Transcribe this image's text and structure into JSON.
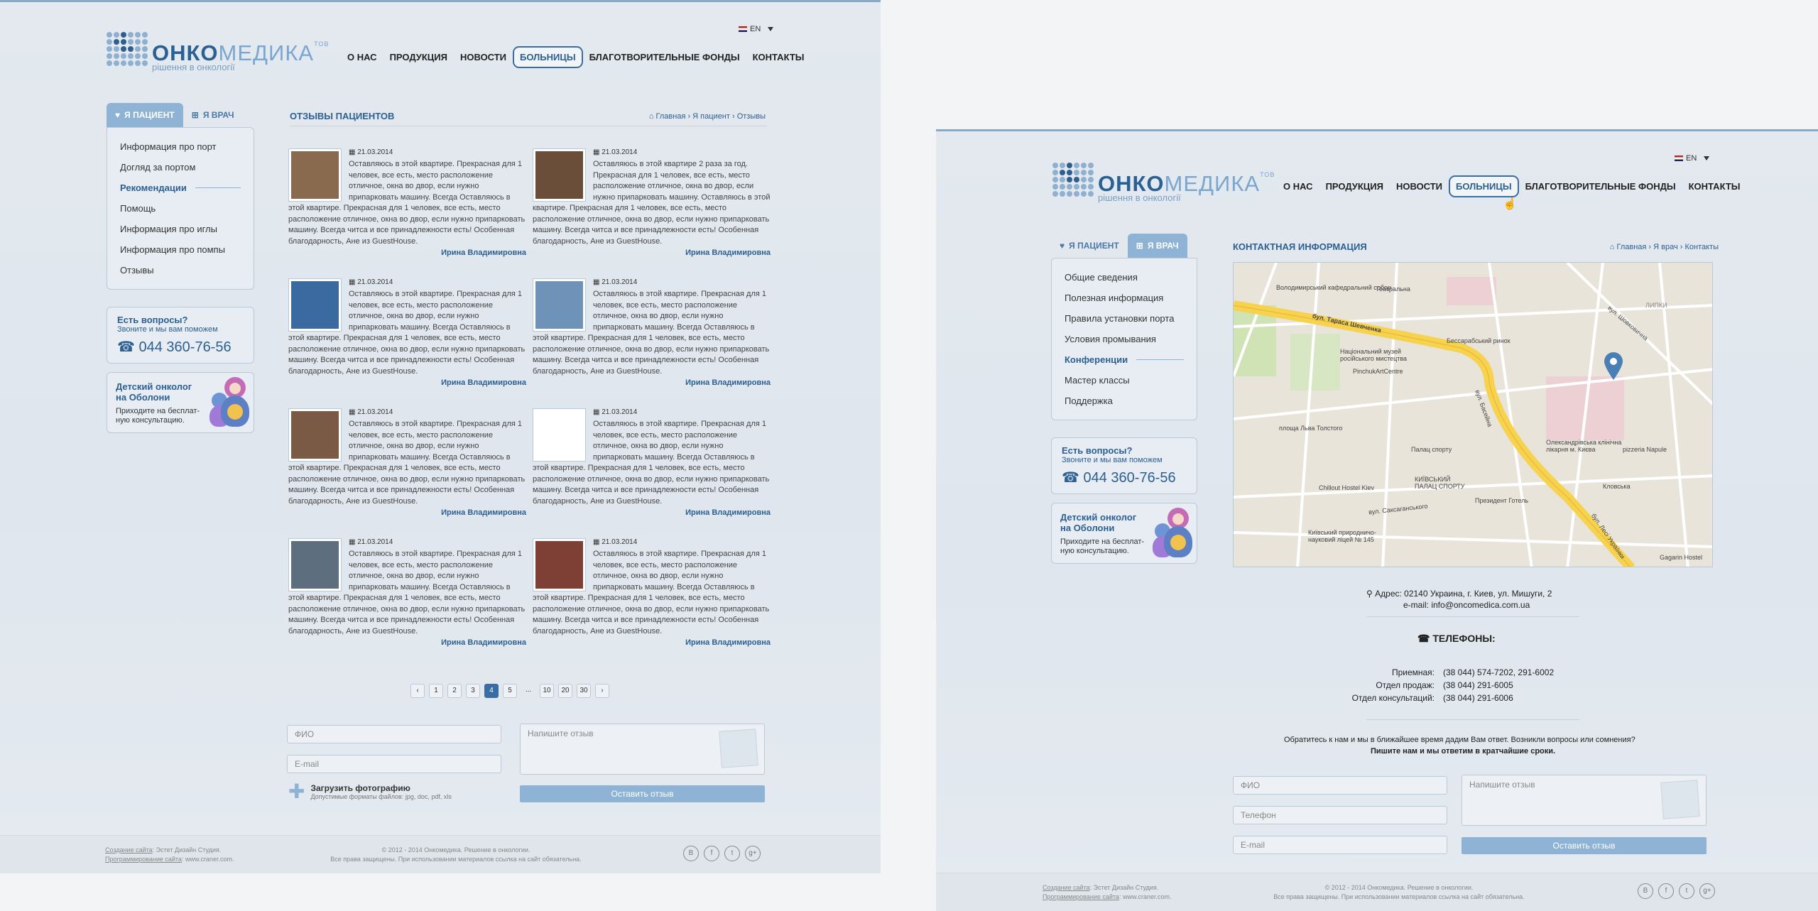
{
  "common": {
    "logo_main": "ОНКО",
    "logo_accent": "МЕДИКА",
    "logo_sup": "TOB",
    "logo_sub": "рішення в онкології",
    "lang": "EN",
    "nav": [
      "О НАС",
      "ПРОДУКЦИЯ",
      "НОВОСТИ",
      "БОЛЬНИЦЫ",
      "БЛАГОТВОРИТЕЛЬНЫЕ ФОНДЫ",
      "КОНТАКТЫ"
    ],
    "tab_patient": "Я ПАЦИЕНТ",
    "tab_doctor": "Я ВРАЧ",
    "question": {
      "title": "Есть вопросы?",
      "sub": "Звоните и мы вам поможем",
      "phone": "044 360-76-56"
    },
    "kids": {
      "title_1": "Детский онколог",
      "title_2": "на Оболони",
      "text_1": "Приходите на бесплат-",
      "text_2": "ную консультацию."
    },
    "footer": {
      "created_label": "Создание сайта",
      "created_by": ": Эстет Дизайн Студия.",
      "prog_label": "Программирование сайта",
      "prog_by": ": www.craner.com.",
      "copy_1": "© 2012 - 2014 Онкомедика. Решение в онкологии.",
      "copy_2": "Все права защищены. При использовании материалов ссылка на сайт обязательна."
    },
    "social": [
      "B",
      "f",
      "t",
      "g+"
    ],
    "form": {
      "name": "ФИО",
      "phone": "Телефон",
      "email": "E-mail",
      "message": "Напишите отзыв",
      "submit": "Оставить отзыв",
      "upload": "Загрузить фотографию",
      "upload_hint": "Допустимые форматы файлов: jpg, doc, pdf, xls"
    }
  },
  "page1": {
    "menu": [
      "Информация про порт",
      "Догляд за портом",
      "Рекомендации",
      "Помощь",
      "Информация про иглы",
      "Информация про помпы",
      "Отзывы"
    ],
    "section_title": "ОТЗЫВЫ ПАЦИЕНТОВ",
    "breadcrumb": "Главная › Я пациент › Отзывы",
    "reviews": [
      {
        "date": "21.03.2014",
        "text": "Оставляюсь в этой квартире. Прекрасная для 1 человек, все есть, место расположение отличное, окна во двор, если нужно припарковать машину. Всегда Оставляюсь в этой квартире. Прекрасная для 1 человек, все есть, место расположение отличное, окна во двор, если нужно припарковать машину. Всегда читса и все принадлежности есть! Особенная благодарность, Ане из GuestHouse.",
        "author": "Ирина Владимировна"
      },
      {
        "date": "21.03.2014",
        "text": "Оставляюсь в этой квартире 2 раза за год. Прекрасная для 1 человек, все есть, место расположение отличное, окна во двор, если нужно припарковать машину. Оставляюсь в этой квартире. Прекрасная для 1 человек, все есть, место расположение отличное, окна во двор, если нужно припарковать машину. Всегда читса и все принадлежности есть! Особенная благодарность, Ане из GuestHouse.",
        "author": "Ирина Владимировна"
      },
      {
        "date": "21.03.2014",
        "text": "Оставляюсь в этой квартире. Прекрасная для 1 человек, все есть, место расположение отличное, окна во двор, если нужно припарковать машину. Всегда Оставляюсь в этой квартире. Прекрасная для 1 человек, все есть, место расположение отличное, окна во двор, если нужно припарковать машину. Всегда читса и все принадлежности есть! Особенная благодарность, Ане из GuestHouse.",
        "author": "Ирина Владимировна"
      },
      {
        "date": "21.03.2014",
        "text": "Оставляюсь в этой квартире. Прекрасная для 1 человек, все есть, место расположение отличное, окна во двор, если нужно припарковать машину. Всегда Оставляюсь в этой квартире. Прекрасная для 1 человек, все есть, место расположение отличное, окна во двор, если нужно припарковать машину. Всегда читса и все принадлежности есть! Особенная благодарность, Ане из GuestHouse.",
        "author": "Ирина Владимировна"
      },
      {
        "date": "21.03.2014",
        "text": "Оставляюсь в этой квартире. Прекрасная для 1 человек, все есть, место расположение отличное, окна во двор, если нужно припарковать машину. Всегда Оставляюсь в этой квартире. Прекрасная для 1 человек, все есть, место расположение отличное, окна во двор, если нужно припарковать машину. Всегда читса и все принадлежности есть! Особенная благодарность, Ане из GuestHouse.",
        "author": "Ирина Владимировна"
      },
      {
        "date": "21.03.2014",
        "text": "Оставляюсь в этой квартире. Прекрасная для 1 человек, все есть, место расположение отличное, окна во двор, если нужно припарковать машину. Всегда Оставляюсь в этой квартире. Прекрасная для 1 человек, все есть, место расположение отличное, окна во двор, если нужно припарковать машину. Всегда читса и все принадлежности есть! Особенная благодарность, Ане из GuestHouse.",
        "author": "Ирина Владимировна"
      },
      {
        "date": "21.03.2014",
        "text": "Оставляюсь в этой квартире. Прекрасная для 1 человек, все есть, место расположение отличное, окна во двор, если нужно припарковать машину. Всегда Оставляюсь в этой квартире. Прекрасная для 1 человек, все есть, место расположение отличное, окна во двор, если нужно припарковать машину. Всегда читса и все принадлежности есть! Особенная благодарность, Ане из GuestHouse.",
        "author": "Ирина Владимировна"
      },
      {
        "date": "21.03.2014",
        "text": "Оставляюсь в этой квартире. Прекрасная для 1 человек, все есть, место расположение отличное, окна во двор, если нужно припарковать машину. Всегда Оставляюсь в этой квартире. Прекрасная для 1 человек, все есть, место расположение отличное, окна во двор, если нужно припарковать машину. Всегда читса и все принадлежности есть! Особенная благодарность, Ане из GuestHouse.",
        "author": "Ирина Владимировна"
      }
    ],
    "pagination": [
      "‹",
      "1",
      "2",
      "3",
      "4",
      "5",
      "...",
      "10",
      "20",
      "30",
      "›"
    ]
  },
  "page2": {
    "menu": [
      "Общие сведения",
      "Полезная информация",
      "Правила установки порта",
      "Условия промывания",
      "Конференции",
      "Мастер классы",
      "Поддержка"
    ],
    "section_title": "КОНТАКТНАЯ ИНФОРМАЦИЯ",
    "breadcrumb": "Главная › Я врач › Контакты",
    "map_labels": [
      "Володимирський кафедральний собор",
      "Театральна",
      "бул. Тараса Шевченка",
      "Бессарабський ринок",
      "Національний музей російського мистецтва",
      "PinchukArtCentre",
      "площа Льва Толстого",
      "Палац спорту",
      "Олександрівська клінічна лікарня м. Києва",
      "pizzeria Napule",
      "Chillout Hostel Kiev",
      "КИЇВСЬКИЙ ПАЛАЦ СПОРТУ",
      "Президент Готель",
      "Кловська",
      "Київський природничо-науковий ліцей № 145",
      "Gagarin Hostel",
      "вул. Саксаганського",
      "вул. Басейна",
      "бул. Лесі Українки",
      "вул. Шовковична",
      "ЛИПКИ"
    ],
    "address": "Адрес: 02140 Украина, г. Киев, ул. Мишуги, 2",
    "email": "e-mail: info@oncomedica.com.ua",
    "phones_title": "ТЕЛЕФОНЫ:",
    "phones": [
      {
        "label": "Приемная:",
        "value": "(38 044) 574-7202, 291-6002"
      },
      {
        "label": "Отдел продаж:",
        "value": "(38 044) 291-6005"
      },
      {
        "label": "Отдел консультаций:",
        "value": "(38 044) 291-6006"
      }
    ],
    "note_1": "Обратитесь к нам и мы в ближайшее время дадим Вам ответ. Возникли вопросы или сомнения?",
    "note_2": "Пишите нам и мы ответим в кратчайшие сроки."
  }
}
